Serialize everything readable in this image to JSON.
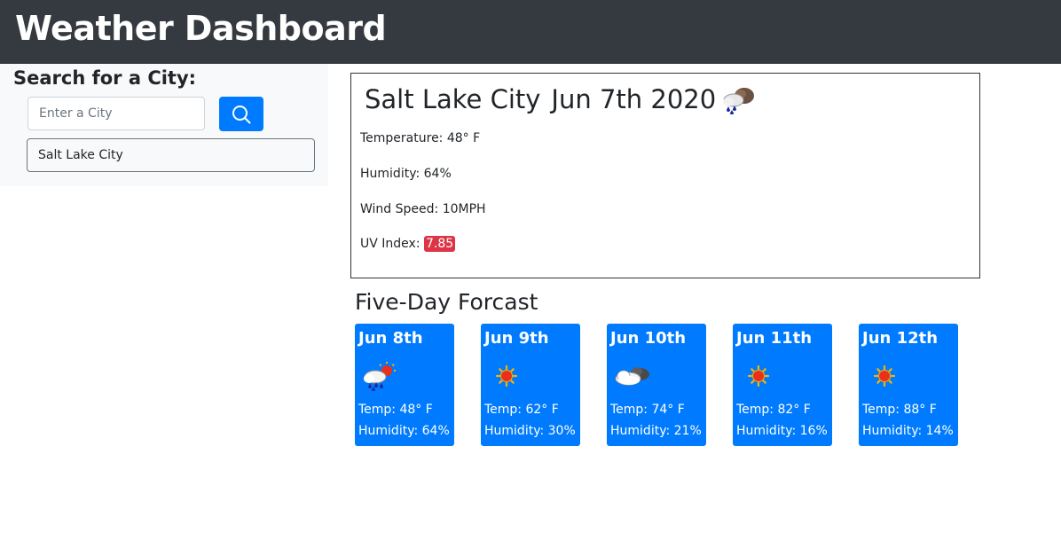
{
  "header": {
    "title": "Weather Dashboard"
  },
  "search": {
    "heading": "Search for a City:",
    "placeholder": "Enter a City",
    "value": "",
    "button_icon": "search-icon",
    "history": [
      "Salt Lake City"
    ]
  },
  "current": {
    "city": "Salt Lake City",
    "date": "Jun 7th 2020",
    "icon": "rain-clouds-icon",
    "temperature": "Temperature: 48° F",
    "humidity": "Humidity: 64%",
    "wind": "Wind Speed: 10MPH",
    "uv_label": "UV Index: ",
    "uv_value": "7.85",
    "uv_color": "#dc3545"
  },
  "forecast": {
    "title": "Five-Day Forcast",
    "card_color": "#007bff",
    "days": [
      {
        "date": "Jun 8th",
        "icon": "sun-rain-cloud-icon",
        "temp": "Temp: 48° F",
        "humidity": "Humidity: 64%"
      },
      {
        "date": "Jun 9th",
        "icon": "sun-icon",
        "temp": "Temp: 62° F",
        "humidity": "Humidity: 30%"
      },
      {
        "date": "Jun 10th",
        "icon": "clouds-icon",
        "temp": "Temp: 74° F",
        "humidity": "Humidity: 21%"
      },
      {
        "date": "Jun 11th",
        "icon": "sun-icon",
        "temp": "Temp: 82° F",
        "humidity": "Humidity: 16%"
      },
      {
        "date": "Jun 12th",
        "icon": "sun-icon",
        "temp": "Temp: 88° F",
        "humidity": "Humidity: 14%"
      }
    ]
  }
}
